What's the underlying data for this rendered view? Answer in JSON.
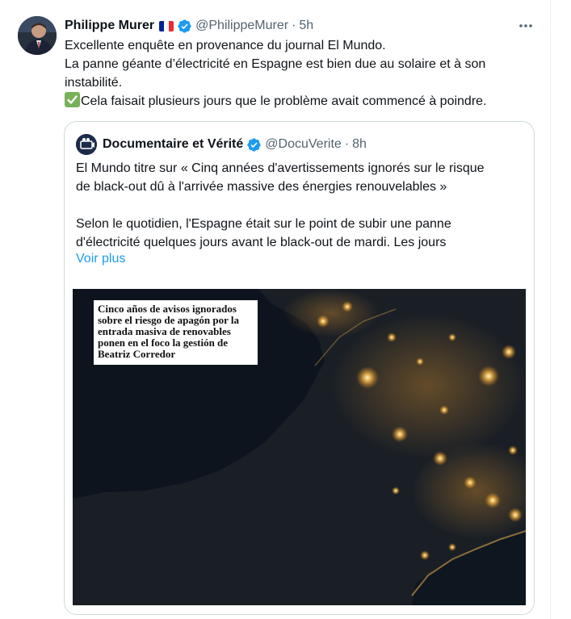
{
  "tweet": {
    "author_name": "Philippe Murer",
    "author_handle": "@PhilippeMurer",
    "separator": "·",
    "time": "5h",
    "lines": [
      "Excellente enquête en provenance du journal El Mundo.",
      "La panne géante d’électricité en Espagne est bien due au solaire et à son",
      "instabilité.",
      "Cela faisait plusieurs jours que le problème avait commencé à poindre."
    ]
  },
  "quoted": {
    "author_name": "Documentaire et Vérité",
    "author_handle": "@DocuVerite",
    "separator": "·",
    "time": "8h",
    "lines": [
      "El Mundo titre sur « Cinq années d'avertissements ignorés sur le risque",
      "de black-out dû à l'arrivée massive des énergies renouvelables »",
      "Selon le quotidien, l'Espagne était sur le point de subir une panne",
      "d'électricité quelques jours avant le black-out de mardi. Les jours"
    ],
    "show_more": "Voir plus",
    "media": {
      "headline_lines": [
        "Cinco años de avisos ignorados",
        "sobre el riesgo de apagón por la",
        "entrada masiva de renovables",
        "ponen en el foco la gestión de",
        "Beatriz Corredor"
      ]
    }
  },
  "icons": {
    "flag": "france-flag-icon",
    "verified": "verified-badge-icon",
    "more": "more-options-icon",
    "check": "check-mark-emoji-icon"
  },
  "colors": {
    "accent": "#1d9bf0",
    "text": "#0f1419",
    "muted": "#536471",
    "border": "#cfd9de",
    "check_emoji": "#78b159"
  }
}
